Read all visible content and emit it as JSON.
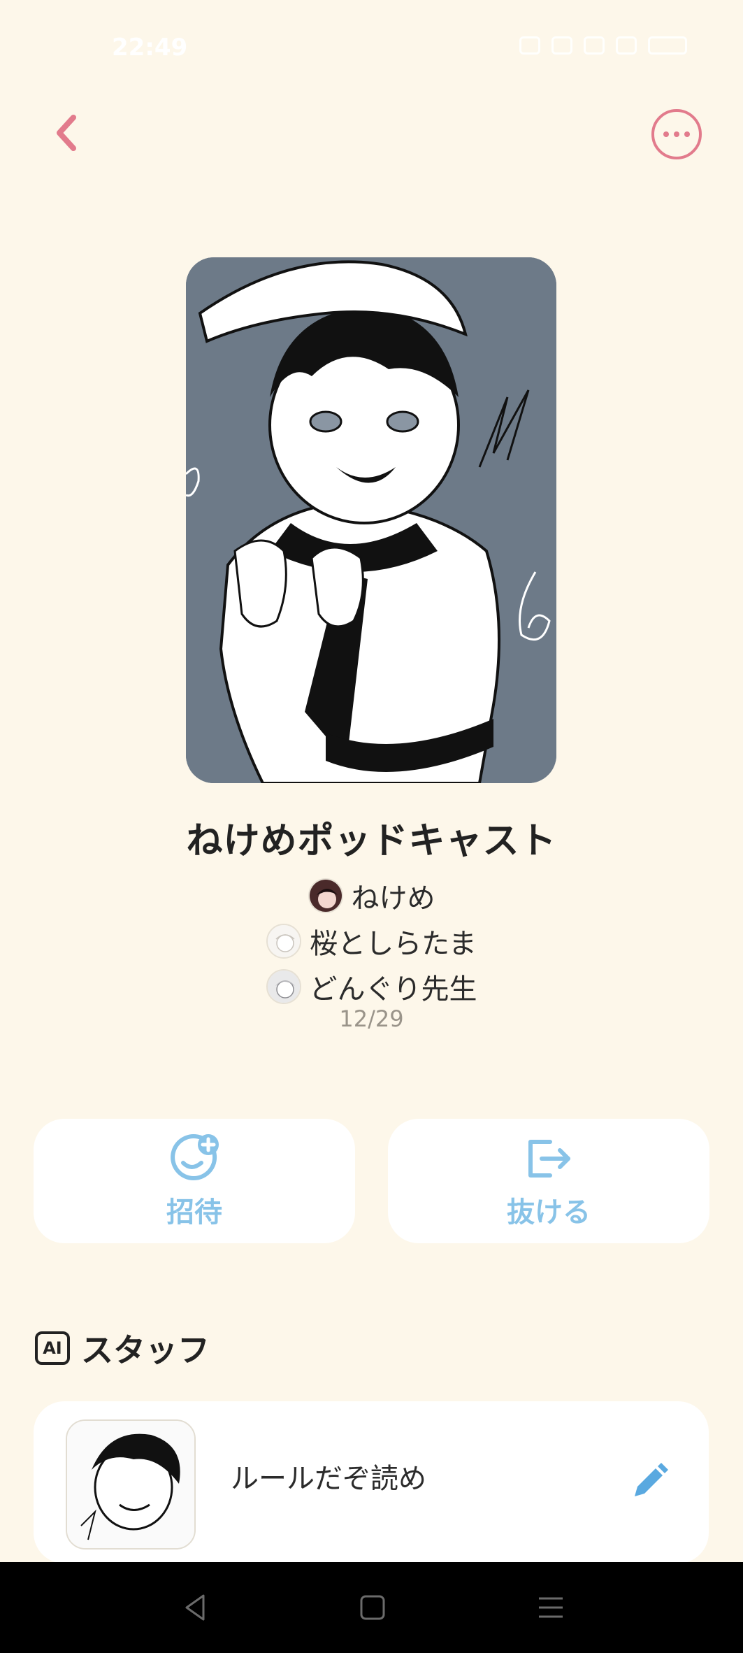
{
  "status_bar": {
    "time": "22:49"
  },
  "header": {
    "back_icon": "chevron-left-icon",
    "more_icon": "more-dots-icon",
    "accent_color": "#e27b8c"
  },
  "room": {
    "title": "ねけめポッドキャスト",
    "members": [
      {
        "name": "ねけめ"
      },
      {
        "name": "桜としらたま"
      },
      {
        "name": "どんぐり先生"
      }
    ],
    "date": "12/29"
  },
  "actions": {
    "invite_label": "招待",
    "invite_icon": "add-user-icon",
    "leave_label": "抜ける",
    "leave_icon": "exit-icon",
    "color": "#88c3e8"
  },
  "staff": {
    "badge": "AI",
    "title": "スタッフ",
    "items": [
      {
        "name": "ルールだぞ読め",
        "edit_icon": "pencil-icon"
      }
    ]
  },
  "nav": {
    "back_icon": "nav-back-icon",
    "home_icon": "nav-home-icon",
    "menu_icon": "nav-menu-icon"
  }
}
